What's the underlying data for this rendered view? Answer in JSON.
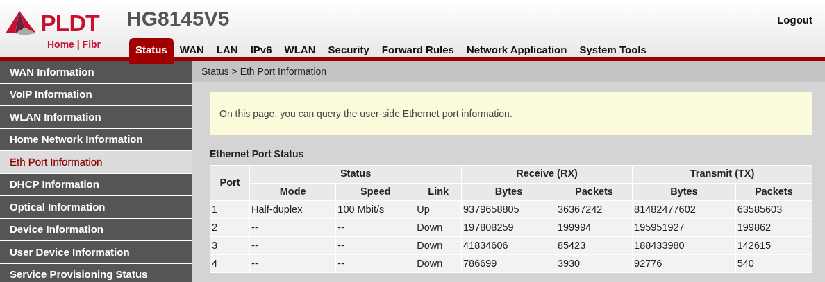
{
  "header": {
    "logo": {
      "brand": "PLDT",
      "tagline": "Home | Fibr"
    },
    "title": "HG8145V5",
    "logout": "Logout",
    "tabs": [
      {
        "label": "Status",
        "selected": true
      },
      {
        "label": "WAN",
        "selected": false
      },
      {
        "label": "LAN",
        "selected": false
      },
      {
        "label": "IPv6",
        "selected": false
      },
      {
        "label": "WLAN",
        "selected": false
      },
      {
        "label": "Security",
        "selected": false
      },
      {
        "label": "Forward Rules",
        "selected": false
      },
      {
        "label": "Network Application",
        "selected": false
      },
      {
        "label": "System Tools",
        "selected": false
      }
    ]
  },
  "sidebar": {
    "items": [
      {
        "label": "WAN Information",
        "selected": false
      },
      {
        "label": "VoIP Information",
        "selected": false
      },
      {
        "label": "WLAN Information",
        "selected": false
      },
      {
        "label": "Home Network Information",
        "selected": false
      },
      {
        "label": "Eth Port Information",
        "selected": true
      },
      {
        "label": "DHCP Information",
        "selected": false
      },
      {
        "label": "Optical Information",
        "selected": false
      },
      {
        "label": "Device Information",
        "selected": false
      },
      {
        "label": "User Device Information",
        "selected": false
      },
      {
        "label": "Service Provisioning Status",
        "selected": false
      }
    ]
  },
  "breadcrumb": "Status > Eth Port Information",
  "notice": "On this page, you can query the user-side Ethernet port information.",
  "section_title": "Ethernet Port Status",
  "table": {
    "column_groups": [
      {
        "label": "Port"
      },
      {
        "label": "Status",
        "columns": [
          "Mode",
          "Speed",
          "Link"
        ]
      },
      {
        "label": "Receive (RX)",
        "columns": [
          "Bytes",
          "Packets"
        ]
      },
      {
        "label": "Transmit (TX)",
        "columns": [
          "Bytes",
          "Packets"
        ]
      }
    ],
    "rows": [
      [
        "1",
        "Half-duplex",
        "100 Mbit/s",
        "Up",
        "9379658805",
        "36367242",
        "81482477602",
        "63585603"
      ],
      [
        "2",
        "--",
        "--",
        "Down",
        "197808259",
        "199994",
        "195951927",
        "199862"
      ],
      [
        "3",
        "--",
        "--",
        "Down",
        "41834606",
        "85423",
        "188433980",
        "142615"
      ],
      [
        "4",
        "--",
        "--",
        "Down",
        "786699",
        "3930",
        "92776",
        "540"
      ]
    ]
  }
}
